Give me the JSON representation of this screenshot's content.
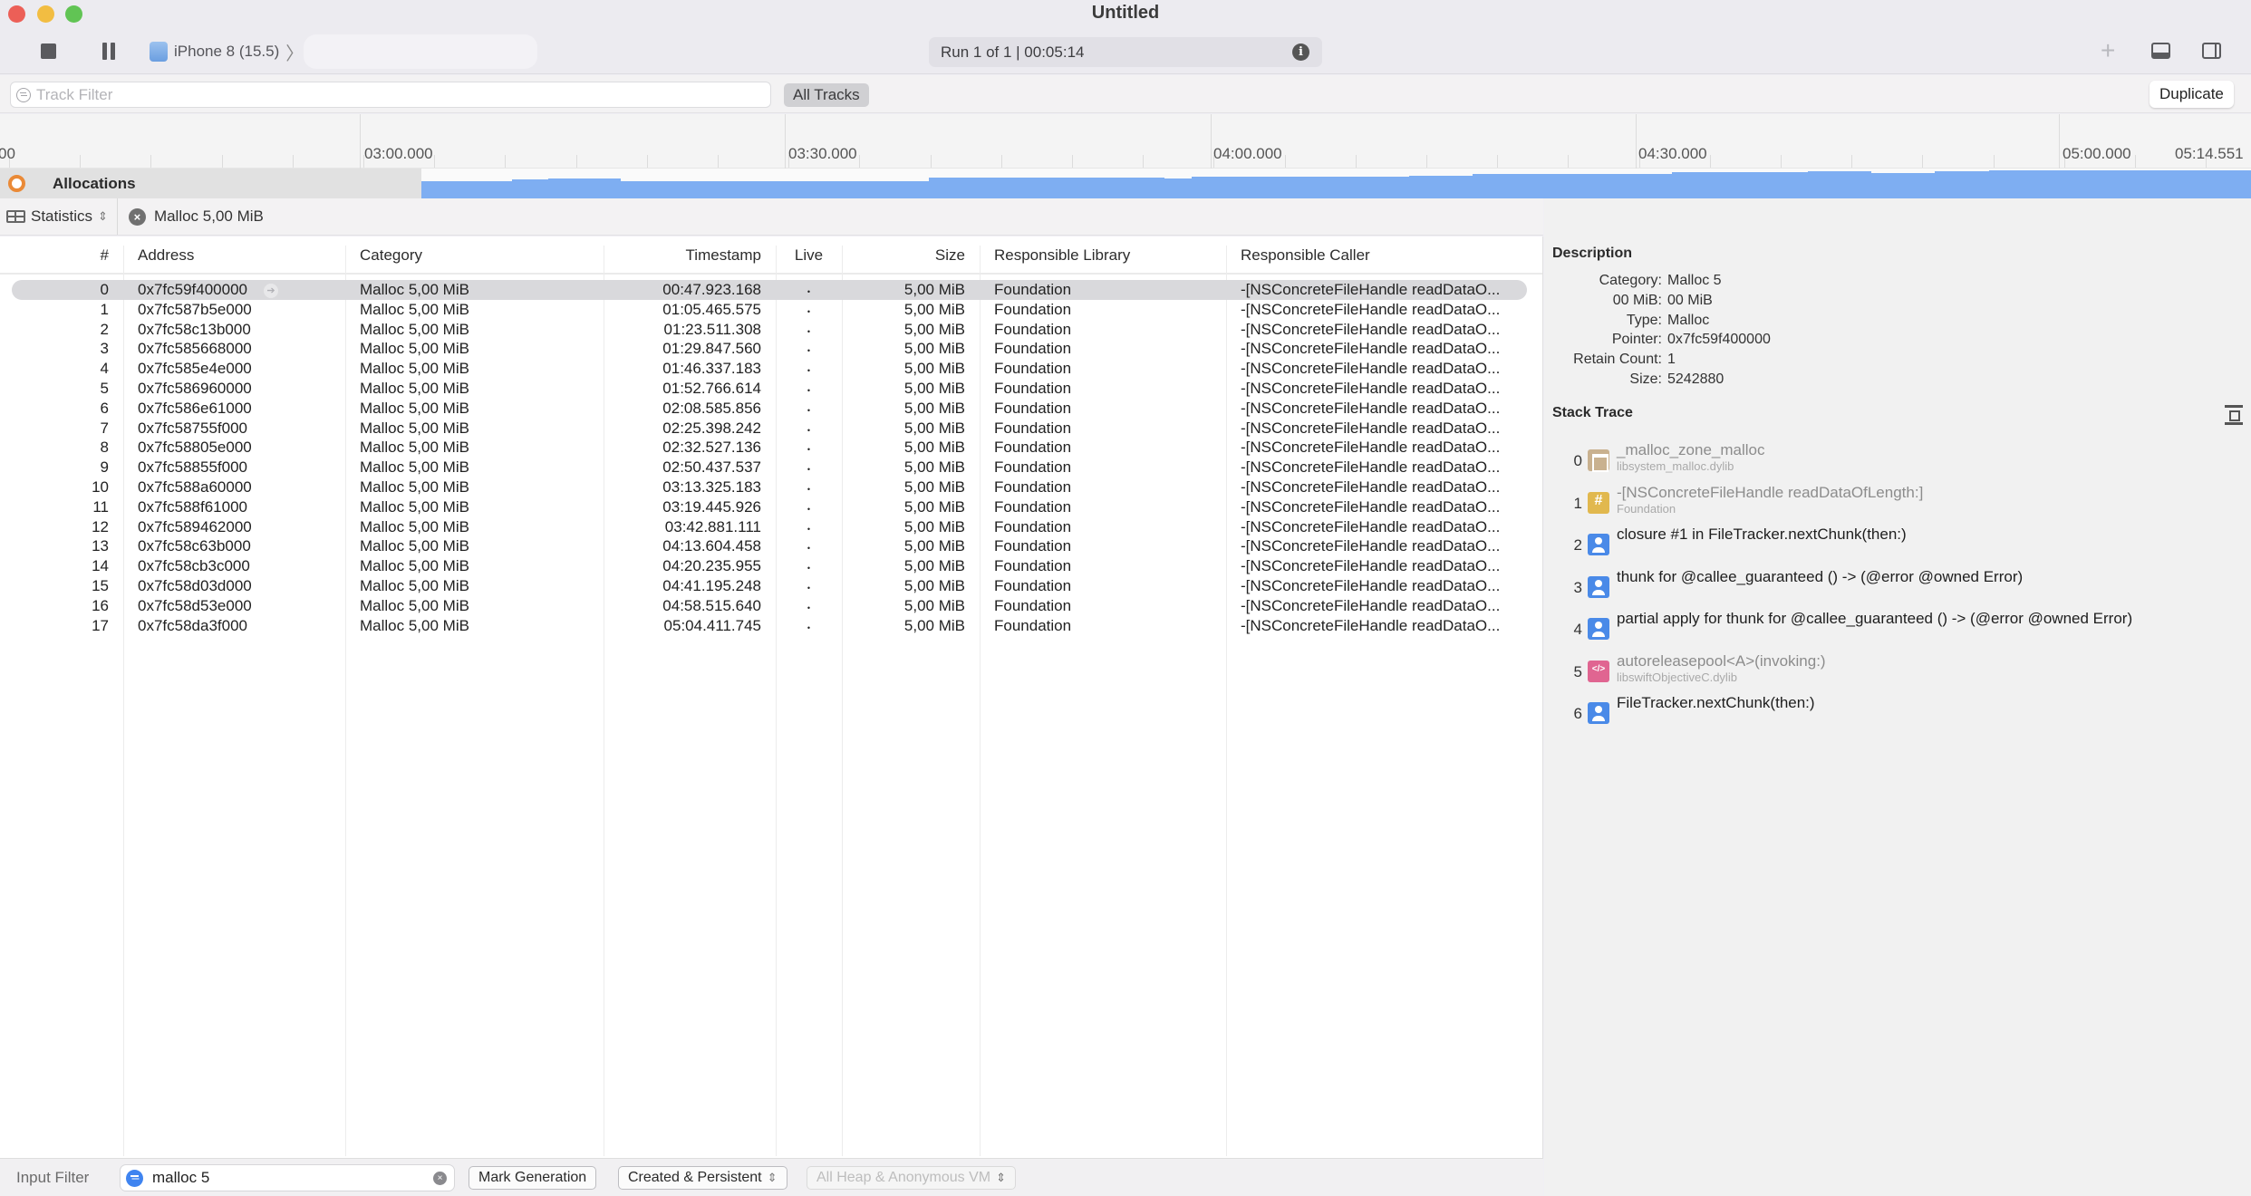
{
  "window": {
    "title": "Untitled",
    "device": "iPhone 8 (15.5)",
    "run_status": "Run 1 of 1  |  00:05:14"
  },
  "filter_bar": {
    "track_filter_placeholder": "Track Filter",
    "all_tracks_label": "All Tracks",
    "duplicate_label": "Duplicate"
  },
  "timeline": {
    "tick_labels": [
      "00",
      "03:00.000",
      "03:30.000",
      "04:00.000",
      "04:30.000",
      "05:00.000",
      "05:14.551"
    ],
    "track_name": "Allocations",
    "track_color": "#7eaef2"
  },
  "stats_bar": {
    "mode_label": "Statistics",
    "breadcrumb_label": "Malloc 5,00 MiB"
  },
  "table": {
    "columns": [
      "#",
      "Address",
      "Category",
      "Timestamp",
      "Live",
      "Size",
      "Responsible Library",
      "Responsible Caller"
    ],
    "selected_index": 0,
    "rows": [
      {
        "num": "0",
        "address": "0x7fc59f400000",
        "category": "Malloc 5,00 MiB",
        "timestamp": "00:47.923.168",
        "live": "•",
        "size": "5,00 MiB",
        "library": "Foundation",
        "caller": "-[NSConcreteFileHandle readDataO..."
      },
      {
        "num": "1",
        "address": "0x7fc587b5e000",
        "category": "Malloc 5,00 MiB",
        "timestamp": "01:05.465.575",
        "live": "•",
        "size": "5,00 MiB",
        "library": "Foundation",
        "caller": "-[NSConcreteFileHandle readDataO..."
      },
      {
        "num": "2",
        "address": "0x7fc58c13b000",
        "category": "Malloc 5,00 MiB",
        "timestamp": "01:23.511.308",
        "live": "•",
        "size": "5,00 MiB",
        "library": "Foundation",
        "caller": "-[NSConcreteFileHandle readDataO..."
      },
      {
        "num": "3",
        "address": "0x7fc585668000",
        "category": "Malloc 5,00 MiB",
        "timestamp": "01:29.847.560",
        "live": "•",
        "size": "5,00 MiB",
        "library": "Foundation",
        "caller": "-[NSConcreteFileHandle readDataO..."
      },
      {
        "num": "4",
        "address": "0x7fc585e4e000",
        "category": "Malloc 5,00 MiB",
        "timestamp": "01:46.337.183",
        "live": "•",
        "size": "5,00 MiB",
        "library": "Foundation",
        "caller": "-[NSConcreteFileHandle readDataO..."
      },
      {
        "num": "5",
        "address": "0x7fc586960000",
        "category": "Malloc 5,00 MiB",
        "timestamp": "01:52.766.614",
        "live": "•",
        "size": "5,00 MiB",
        "library": "Foundation",
        "caller": "-[NSConcreteFileHandle readDataO..."
      },
      {
        "num": "6",
        "address": "0x7fc586e61000",
        "category": "Malloc 5,00 MiB",
        "timestamp": "02:08.585.856",
        "live": "•",
        "size": "5,00 MiB",
        "library": "Foundation",
        "caller": "-[NSConcreteFileHandle readDataO..."
      },
      {
        "num": "7",
        "address": "0x7fc58755f000",
        "category": "Malloc 5,00 MiB",
        "timestamp": "02:25.398.242",
        "live": "•",
        "size": "5,00 MiB",
        "library": "Foundation",
        "caller": "-[NSConcreteFileHandle readDataO..."
      },
      {
        "num": "8",
        "address": "0x7fc58805e000",
        "category": "Malloc 5,00 MiB",
        "timestamp": "02:32.527.136",
        "live": "•",
        "size": "5,00 MiB",
        "library": "Foundation",
        "caller": "-[NSConcreteFileHandle readDataO..."
      },
      {
        "num": "9",
        "address": "0x7fc58855f000",
        "category": "Malloc 5,00 MiB",
        "timestamp": "02:50.437.537",
        "live": "•",
        "size": "5,00 MiB",
        "library": "Foundation",
        "caller": "-[NSConcreteFileHandle readDataO..."
      },
      {
        "num": "10",
        "address": "0x7fc588a60000",
        "category": "Malloc 5,00 MiB",
        "timestamp": "03:13.325.183",
        "live": "•",
        "size": "5,00 MiB",
        "library": "Foundation",
        "caller": "-[NSConcreteFileHandle readDataO..."
      },
      {
        "num": "11",
        "address": "0x7fc588f61000",
        "category": "Malloc 5,00 MiB",
        "timestamp": "03:19.445.926",
        "live": "•",
        "size": "5,00 MiB",
        "library": "Foundation",
        "caller": "-[NSConcreteFileHandle readDataO..."
      },
      {
        "num": "12",
        "address": "0x7fc589462000",
        "category": "Malloc 5,00 MiB",
        "timestamp": "03:42.881.111",
        "live": "•",
        "size": "5,00 MiB",
        "library": "Foundation",
        "caller": "-[NSConcreteFileHandle readDataO..."
      },
      {
        "num": "13",
        "address": "0x7fc58c63b000",
        "category": "Malloc 5,00 MiB",
        "timestamp": "04:13.604.458",
        "live": "•",
        "size": "5,00 MiB",
        "library": "Foundation",
        "caller": "-[NSConcreteFileHandle readDataO..."
      },
      {
        "num": "14",
        "address": "0x7fc58cb3c000",
        "category": "Malloc 5,00 MiB",
        "timestamp": "04:20.235.955",
        "live": "•",
        "size": "5,00 MiB",
        "library": "Foundation",
        "caller": "-[NSConcreteFileHandle readDataO..."
      },
      {
        "num": "15",
        "address": "0x7fc58d03d000",
        "category": "Malloc 5,00 MiB",
        "timestamp": "04:41.195.248",
        "live": "•",
        "size": "5,00 MiB",
        "library": "Foundation",
        "caller": "-[NSConcreteFileHandle readDataO..."
      },
      {
        "num": "16",
        "address": "0x7fc58d53e000",
        "category": "Malloc 5,00 MiB",
        "timestamp": "04:58.515.640",
        "live": "•",
        "size": "5,00 MiB",
        "library": "Foundation",
        "caller": "-[NSConcreteFileHandle readDataO..."
      },
      {
        "num": "17",
        "address": "0x7fc58da3f000",
        "category": "Malloc 5,00 MiB",
        "timestamp": "05:04.411.745",
        "live": "•",
        "size": "5,00 MiB",
        "library": "Foundation",
        "caller": "-[NSConcreteFileHandle readDataO..."
      }
    ]
  },
  "detail": {
    "description_title": "Description",
    "fields": [
      {
        "key": "Category:",
        "value": "Malloc 5"
      },
      {
        "key": "00 MiB:",
        "value": "00 MiB"
      },
      {
        "key": "Type:",
        "value": "Malloc"
      },
      {
        "key": "Pointer:",
        "value": "0x7fc59f400000"
      },
      {
        "key": "Retain Count:",
        "value": "1"
      },
      {
        "key": "Size:",
        "value": "5242880"
      }
    ],
    "stack_trace_title": "Stack Trace",
    "frames": [
      {
        "num": "0",
        "icon": "system-library-icon",
        "kind": "sys",
        "symbol": "_malloc_zone_malloc",
        "library": "libsystem_malloc.dylib",
        "dim": true
      },
      {
        "num": "1",
        "icon": "foundation-icon",
        "kind": "fnd",
        "symbol": "-[NSConcreteFileHandle readDataOfLength:]",
        "library": "Foundation",
        "dim": true
      },
      {
        "num": "2",
        "icon": "user-code-icon",
        "kind": "usr",
        "symbol": "closure #1 in FileTracker.nextChunk(then:)",
        "library": "",
        "dim": false
      },
      {
        "num": "3",
        "icon": "user-code-icon",
        "kind": "usr",
        "symbol": "thunk for @callee_guaranteed () -> (@error @owned Error)",
        "library": "",
        "dim": false
      },
      {
        "num": "4",
        "icon": "user-code-icon",
        "kind": "usr",
        "symbol": "partial apply for thunk for @callee_guaranteed () -> (@error @owned Error)",
        "library": "",
        "dim": false
      },
      {
        "num": "5",
        "icon": "swift-library-icon",
        "kind": "swift",
        "symbol": "autoreleasepool<A>(invoking:)",
        "library": "libswiftObjectiveC.dylib",
        "dim": true
      },
      {
        "num": "6",
        "icon": "user-code-icon",
        "kind": "usr",
        "symbol": "FileTracker.nextChunk(then:)",
        "library": "",
        "dim": false
      }
    ]
  },
  "bottom_bar": {
    "input_filter_label": "Input Filter",
    "input_filter_value": "malloc 5",
    "mark_generation_label": "Mark Generation",
    "lifespan_select": "Created & Persistent",
    "heap_select": "All Heap & Anonymous VM"
  }
}
